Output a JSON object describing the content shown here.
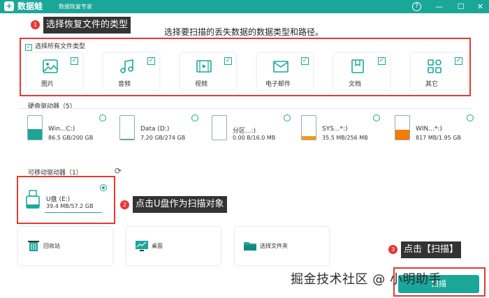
{
  "window": {
    "logo_char": "+",
    "app_name": "数据蛙",
    "subtitle": "数据恢复专家",
    "controls": {
      "help": "?",
      "minimize": "—",
      "maximize": "☐",
      "close": "✕"
    }
  },
  "annotations": [
    {
      "number": "1",
      "text": "选择恢复文件的类型"
    },
    {
      "number": "2",
      "text": "点击U盘作为扫描对象"
    },
    {
      "number": "3",
      "text": "点击【扫描】"
    }
  ],
  "instruction": "选择要扫描的丢失数据的数据类型和路径。",
  "file_types": {
    "select_all_label": "选择所有文件类型",
    "check_mark": "✓",
    "items": [
      {
        "label": "图片",
        "icon": "image-icon"
      },
      {
        "label": "音频",
        "icon": "music-icon"
      },
      {
        "label": "视频",
        "icon": "video-icon"
      },
      {
        "label": "电子邮件",
        "icon": "email-icon"
      },
      {
        "label": "文档",
        "icon": "document-icon"
      },
      {
        "label": "其它",
        "icon": "other-icon"
      }
    ]
  },
  "hard_drives": {
    "title": "硬盘驱动器（5）",
    "items": [
      {
        "name": "Win...C:)",
        "size": "86.5 GB/200 GB",
        "fill": 0.43,
        "color": "#1aa79a"
      },
      {
        "name": "Data (D:)",
        "size": "7.20 GB/274 GB",
        "fill": 0.03,
        "color": "#1aa79a"
      },
      {
        "name": "分区...:)",
        "size": "0.00  B/16.0 MB",
        "fill": 0.0,
        "color": "#1aa79a"
      },
      {
        "name": "SYS...*:)",
        "size": "35.5 MB/256 MB",
        "fill": 0.14,
        "color": "#f59a1a"
      },
      {
        "name": "WIN...*:)",
        "size": "817 MB/1.95 GB",
        "fill": 0.42,
        "color": "#f57c00"
      }
    ]
  },
  "removable": {
    "title": "可移动驱动器（1）",
    "usb_name": "U盘 (E:)",
    "usb_size": "39.4 MB/57.2 GB"
  },
  "locations": [
    {
      "label": "回收站",
      "icon": "recycle-bin-icon"
    },
    {
      "label": "桌面",
      "icon": "desktop-icon"
    },
    {
      "label": "选择文件夹",
      "icon": "folder-icon"
    }
  ],
  "scan_button": "扫描",
  "watermark": "掘金技术社区 @ 小明助手"
}
